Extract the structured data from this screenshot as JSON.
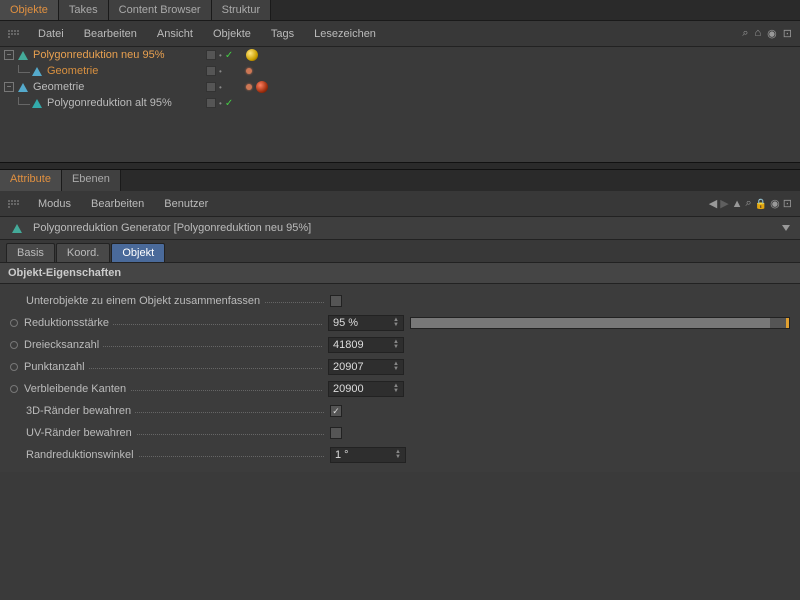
{
  "top_tabs": {
    "objekte": "Objekte",
    "takes": "Takes",
    "content_browser": "Content Browser",
    "struktur": "Struktur"
  },
  "obj_menu": {
    "datei": "Datei",
    "bearbeiten": "Bearbeiten",
    "ansicht": "Ansicht",
    "objekte": "Objekte",
    "tags": "Tags",
    "lesezeichen": "Lesezeichen"
  },
  "tree": {
    "polyreduce_new": "Polygonreduktion neu 95%",
    "geometrie_child": "Geometrie",
    "geometrie_root": "Geometrie",
    "polyreduce_old": "Polygonreduktion alt 95%"
  },
  "attr_tabs": {
    "attribute": "Attribute",
    "ebenen": "Ebenen"
  },
  "attr_menu": {
    "modus": "Modus",
    "bearbeiten": "Bearbeiten",
    "benutzer": "Benutzer"
  },
  "generator_title": "Polygonreduktion Generator [Polygonreduktion neu 95%]",
  "mode_tabs": {
    "basis": "Basis",
    "koord": "Koord.",
    "objekt": "Objekt"
  },
  "section": "Objekt-Eigenschaften",
  "props": {
    "merge_subobjects": "Unterobjekte zu einem Objekt zusammenfassen",
    "reduction_strength": "Reduktionsstärke",
    "reduction_strength_val": "95 %",
    "triangle_count": "Dreiecksanzahl",
    "triangle_count_val": "41809",
    "point_count": "Punktanzahl",
    "point_count_val": "20907",
    "remaining_edges": "Verbleibende Kanten",
    "remaining_edges_val": "20900",
    "keep_3d_borders": "3D-Ränder bewahren",
    "keep_uv_borders": "UV-Ränder bewahren",
    "edge_angle": "Randreduktionswinkel",
    "edge_angle_val": "1 °"
  },
  "chart_data": {
    "type": "bar",
    "title": "Reduktionsstärke slider",
    "categories": [
      "value"
    ],
    "values": [
      95
    ],
    "ylim": [
      0,
      100
    ]
  }
}
